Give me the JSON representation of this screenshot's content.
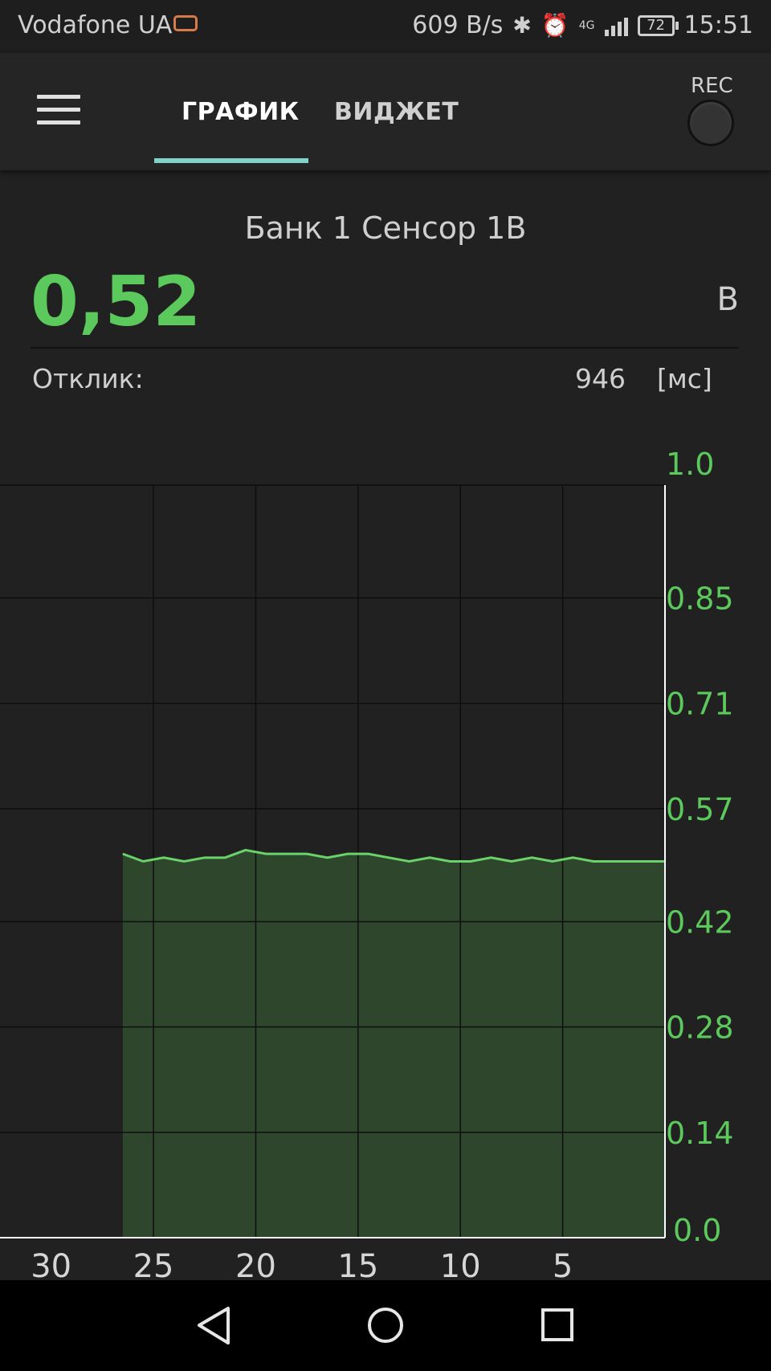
{
  "status_bar": {
    "carrier": "Vodafone UA",
    "net_speed": "609 B/s",
    "network": "4G",
    "battery": "72",
    "time": "15:51"
  },
  "app_bar": {
    "tabs": [
      {
        "label": "ГРАФИК",
        "active": true
      },
      {
        "label": "ВИДЖЕТ",
        "active": false
      }
    ],
    "rec_label": "REC",
    "accent_color": "#7fd3c9"
  },
  "sensor": {
    "name": "Банк 1 Сенсор 1В",
    "value": "0,52",
    "unit": "В",
    "response_label": "Отклик:",
    "response_value": "946",
    "response_unit": "[мс]",
    "value_color": "#5cc95c"
  },
  "chart_data": {
    "type": "area",
    "yticks": [
      "1.0",
      "0.85",
      "0.71",
      "0.57",
      "0.42",
      "0.28",
      "0.14",
      "0.0"
    ],
    "xticks": [
      "30",
      "25",
      "20",
      "15",
      "10",
      "5"
    ],
    "xlim": [
      32.5,
      0
    ],
    "ylim": [
      0,
      1.0
    ],
    "series": [
      {
        "x": [
          26.5,
          25.5,
          24.5,
          23.5,
          22.5,
          21.5,
          20.5,
          19.5,
          18.5,
          17.5,
          16.5,
          15.5,
          14.5,
          13.5,
          12.5,
          11.5,
          10.5,
          9.5,
          8.5,
          7.5,
          6.5,
          5.5,
          4.5,
          3.5,
          2.5,
          1.5,
          0.5,
          0
        ],
        "values": [
          0.51,
          0.5,
          0.505,
          0.5,
          0.505,
          0.505,
          0.515,
          0.51,
          0.51,
          0.51,
          0.505,
          0.51,
          0.51,
          0.505,
          0.5,
          0.505,
          0.5,
          0.5,
          0.505,
          0.5,
          0.505,
          0.5,
          0.505,
          0.5,
          0.5,
          0.5,
          0.5,
          0.5
        ]
      }
    ],
    "line_color": "#6ad26a",
    "fill_color": "#2f4a2d",
    "tick_color": "#5cc95c"
  },
  "nav_bar": {
    "back": "back-icon",
    "home": "home-icon",
    "recents": "recents-icon"
  }
}
